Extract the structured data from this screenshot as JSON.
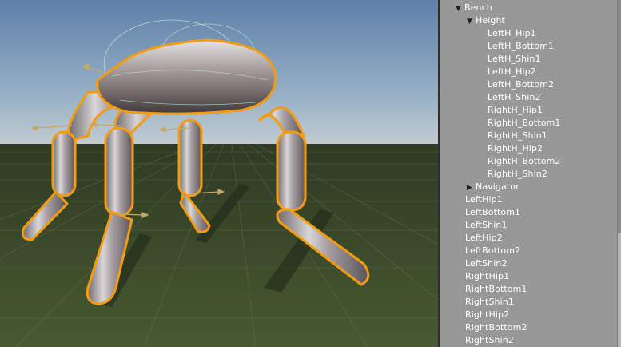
{
  "scene_view": {
    "content": "3D scene of a four-legged ragdoll rig with orange selection outlines on a grid ground plane"
  },
  "hierarchy": {
    "items": [
      {
        "label": "Bench",
        "depth": 1,
        "expanded": true
      },
      {
        "label": "Height",
        "depth": 2,
        "expanded": true
      },
      {
        "label": "LeftH_Hip1",
        "depth": 3
      },
      {
        "label": "LeftH_Bottom1",
        "depth": 3
      },
      {
        "label": "LeftH_Shin1",
        "depth": 3
      },
      {
        "label": "LeftH_Hip2",
        "depth": 3
      },
      {
        "label": "LeftH_Bottom2",
        "depth": 3
      },
      {
        "label": "LeftH_Shin2",
        "depth": 3
      },
      {
        "label": "RightH_Hip1",
        "depth": 3
      },
      {
        "label": "RightH_Bottom1",
        "depth": 3
      },
      {
        "label": "RightH_Shin1",
        "depth": 3
      },
      {
        "label": "RightH_Hip2",
        "depth": 3
      },
      {
        "label": "RightH_Bottom2",
        "depth": 3
      },
      {
        "label": "RightH_Shin2",
        "depth": 3
      },
      {
        "label": "Navigator",
        "depth": 2,
        "expanded": false
      },
      {
        "label": "LeftHip1",
        "depth": 0
      },
      {
        "label": "LeftBottom1",
        "depth": 0
      },
      {
        "label": "LeftShin1",
        "depth": 0
      },
      {
        "label": "LeftHip2",
        "depth": 0
      },
      {
        "label": "LeftBottom2",
        "depth": 0
      },
      {
        "label": "LeftShin2",
        "depth": 0
      },
      {
        "label": "RightHip1",
        "depth": 0
      },
      {
        "label": "RightBottom1",
        "depth": 0
      },
      {
        "label": "RightShin1",
        "depth": 0
      },
      {
        "label": "RightHip2",
        "depth": 0
      },
      {
        "label": "RightBottom2",
        "depth": 0
      },
      {
        "label": "RightShin2",
        "depth": 0
      }
    ]
  },
  "colors": {
    "hierarchy_bg": "#989898",
    "selection_outline": "#f39c12",
    "ground": "#3b4a2a"
  }
}
